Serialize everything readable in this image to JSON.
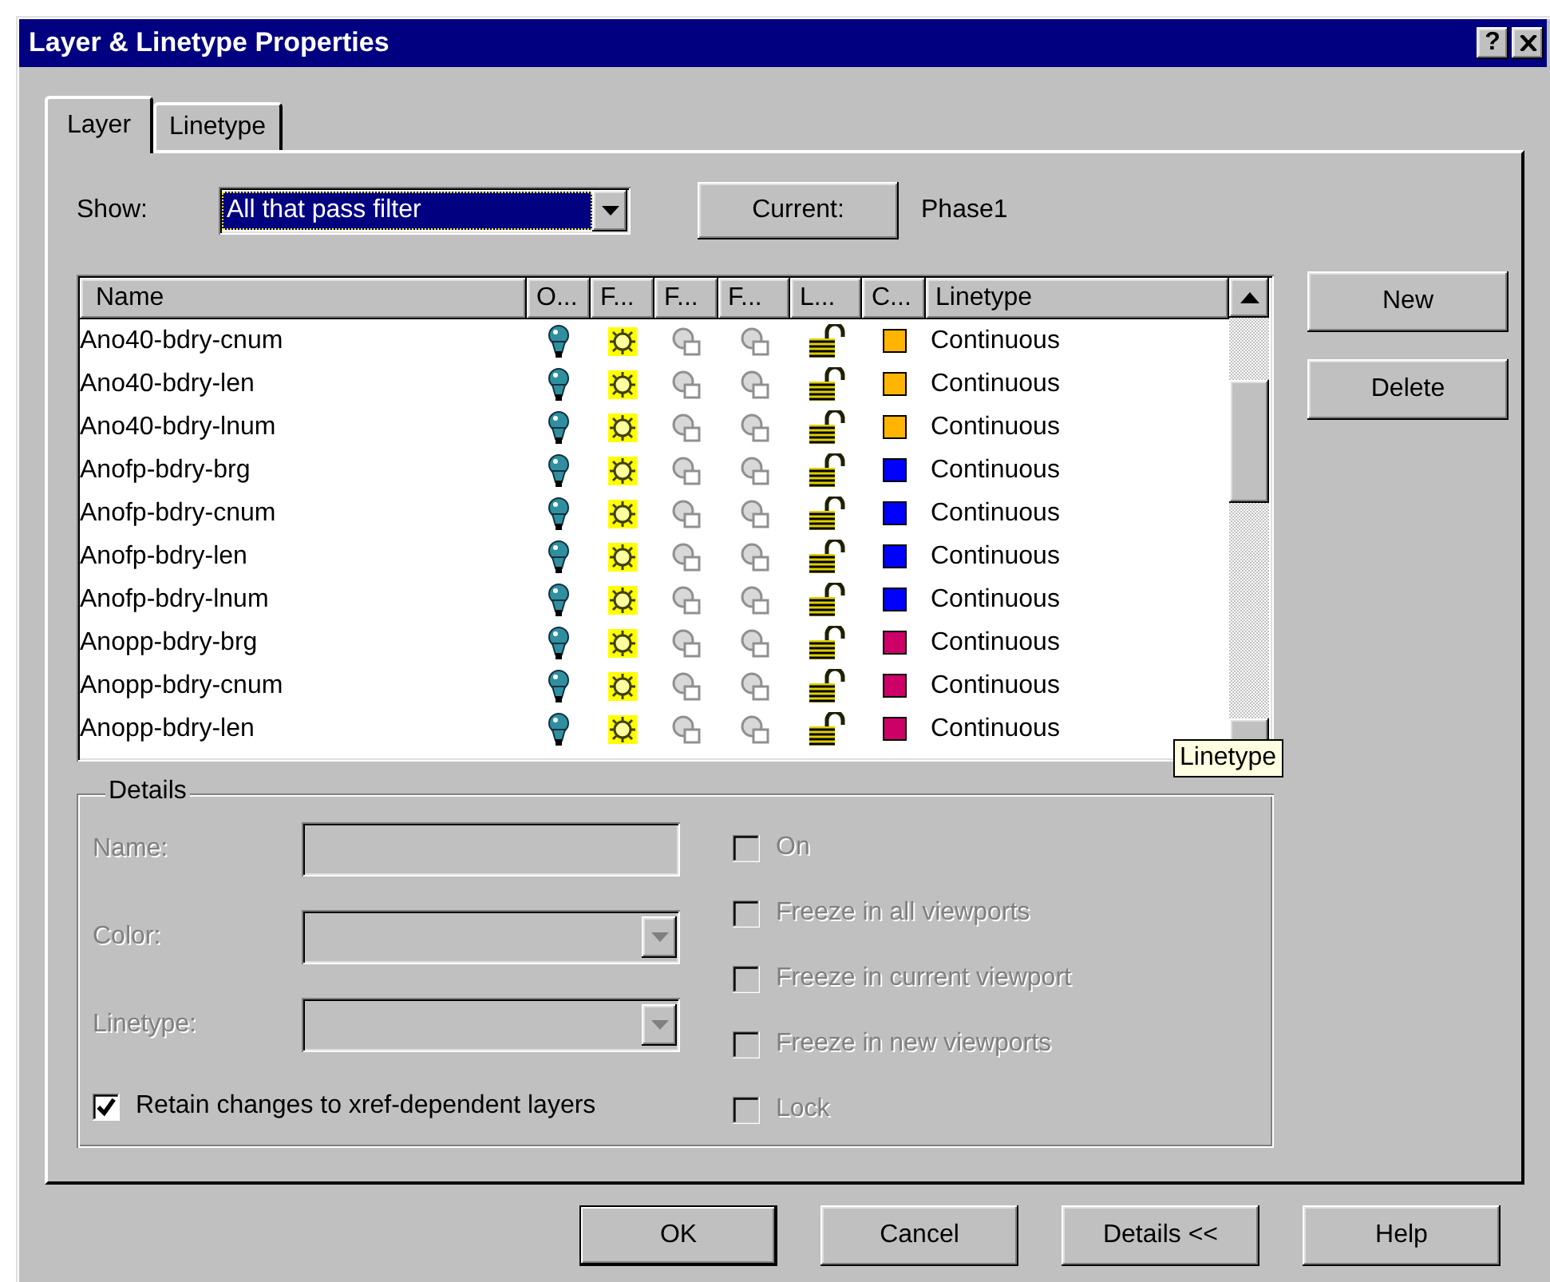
{
  "window": {
    "title": "Layer & Linetype Properties",
    "help_button": "?"
  },
  "tabs": [
    {
      "label": "Layer",
      "selected": true
    },
    {
      "label": "Linetype",
      "selected": false
    }
  ],
  "show": {
    "label": "Show:",
    "value": "All that pass filter"
  },
  "current": {
    "button": "Current:",
    "value": "Phase1"
  },
  "layer_list": {
    "columns": [
      "Name",
      "O...",
      "F...",
      "F...",
      "F...",
      "L...",
      "C...",
      "Linetype"
    ],
    "rows": [
      {
        "name": "Ano40-bdry-cnum",
        "on": true,
        "frozen": false,
        "vp_frozen": false,
        "new_vp_frozen": false,
        "locked": false,
        "color": "#ffb400",
        "linetype": "Continuous"
      },
      {
        "name": "Ano40-bdry-len",
        "on": true,
        "frozen": false,
        "vp_frozen": false,
        "new_vp_frozen": false,
        "locked": false,
        "color": "#ffb400",
        "linetype": "Continuous"
      },
      {
        "name": "Ano40-bdry-lnum",
        "on": true,
        "frozen": false,
        "vp_frozen": false,
        "new_vp_frozen": false,
        "locked": false,
        "color": "#ffb400",
        "linetype": "Continuous"
      },
      {
        "name": "Anofp-bdry-brg",
        "on": true,
        "frozen": false,
        "vp_frozen": false,
        "new_vp_frozen": false,
        "locked": false,
        "color": "#0000ff",
        "linetype": "Continuous"
      },
      {
        "name": "Anofp-bdry-cnum",
        "on": true,
        "frozen": false,
        "vp_frozen": false,
        "new_vp_frozen": false,
        "locked": false,
        "color": "#0000ff",
        "linetype": "Continuous"
      },
      {
        "name": "Anofp-bdry-len",
        "on": true,
        "frozen": false,
        "vp_frozen": false,
        "new_vp_frozen": false,
        "locked": false,
        "color": "#0000ff",
        "linetype": "Continuous"
      },
      {
        "name": "Anofp-bdry-lnum",
        "on": true,
        "frozen": false,
        "vp_frozen": false,
        "new_vp_frozen": false,
        "locked": false,
        "color": "#0000ff",
        "linetype": "Continuous"
      },
      {
        "name": "Anopp-bdry-brg",
        "on": true,
        "frozen": false,
        "vp_frozen": false,
        "new_vp_frozen": false,
        "locked": false,
        "color": "#cc0066",
        "linetype": "Continuous"
      },
      {
        "name": "Anopp-bdry-cnum",
        "on": true,
        "frozen": false,
        "vp_frozen": false,
        "new_vp_frozen": false,
        "locked": false,
        "color": "#cc0066",
        "linetype": "Continuous"
      },
      {
        "name": "Anopp-bdry-len",
        "on": true,
        "frozen": false,
        "vp_frozen": false,
        "new_vp_frozen": false,
        "locked": false,
        "color": "#cc0066",
        "linetype": "Continuous"
      }
    ],
    "tooltip": "Linetype"
  },
  "side_buttons": [
    "New",
    "Delete"
  ],
  "details": {
    "legend": "Details",
    "fields": [
      {
        "label": "Name:",
        "kind": "text",
        "disabled": true
      },
      {
        "label": "Color:",
        "kind": "dropdown",
        "disabled": true
      },
      {
        "label": "Linetype:",
        "kind": "dropdown",
        "disabled": true
      }
    ],
    "retain": {
      "label": "Retain changes to xref-dependent layers",
      "checked": true
    },
    "options": [
      {
        "label": "On",
        "checked": false,
        "disabled": true
      },
      {
        "label": "Freeze in all viewports",
        "checked": false,
        "disabled": true
      },
      {
        "label": "Freeze in current viewport",
        "checked": false,
        "disabled": true
      },
      {
        "label": "Freeze in new viewports",
        "checked": false,
        "disabled": true
      },
      {
        "label": "Lock",
        "checked": false,
        "disabled": true
      }
    ]
  },
  "buttons": [
    {
      "label": "OK",
      "default": true
    },
    {
      "label": "Cancel",
      "default": false
    },
    {
      "label": "Details <<",
      "default": false
    },
    {
      "label": "Help",
      "default": false
    }
  ]
}
